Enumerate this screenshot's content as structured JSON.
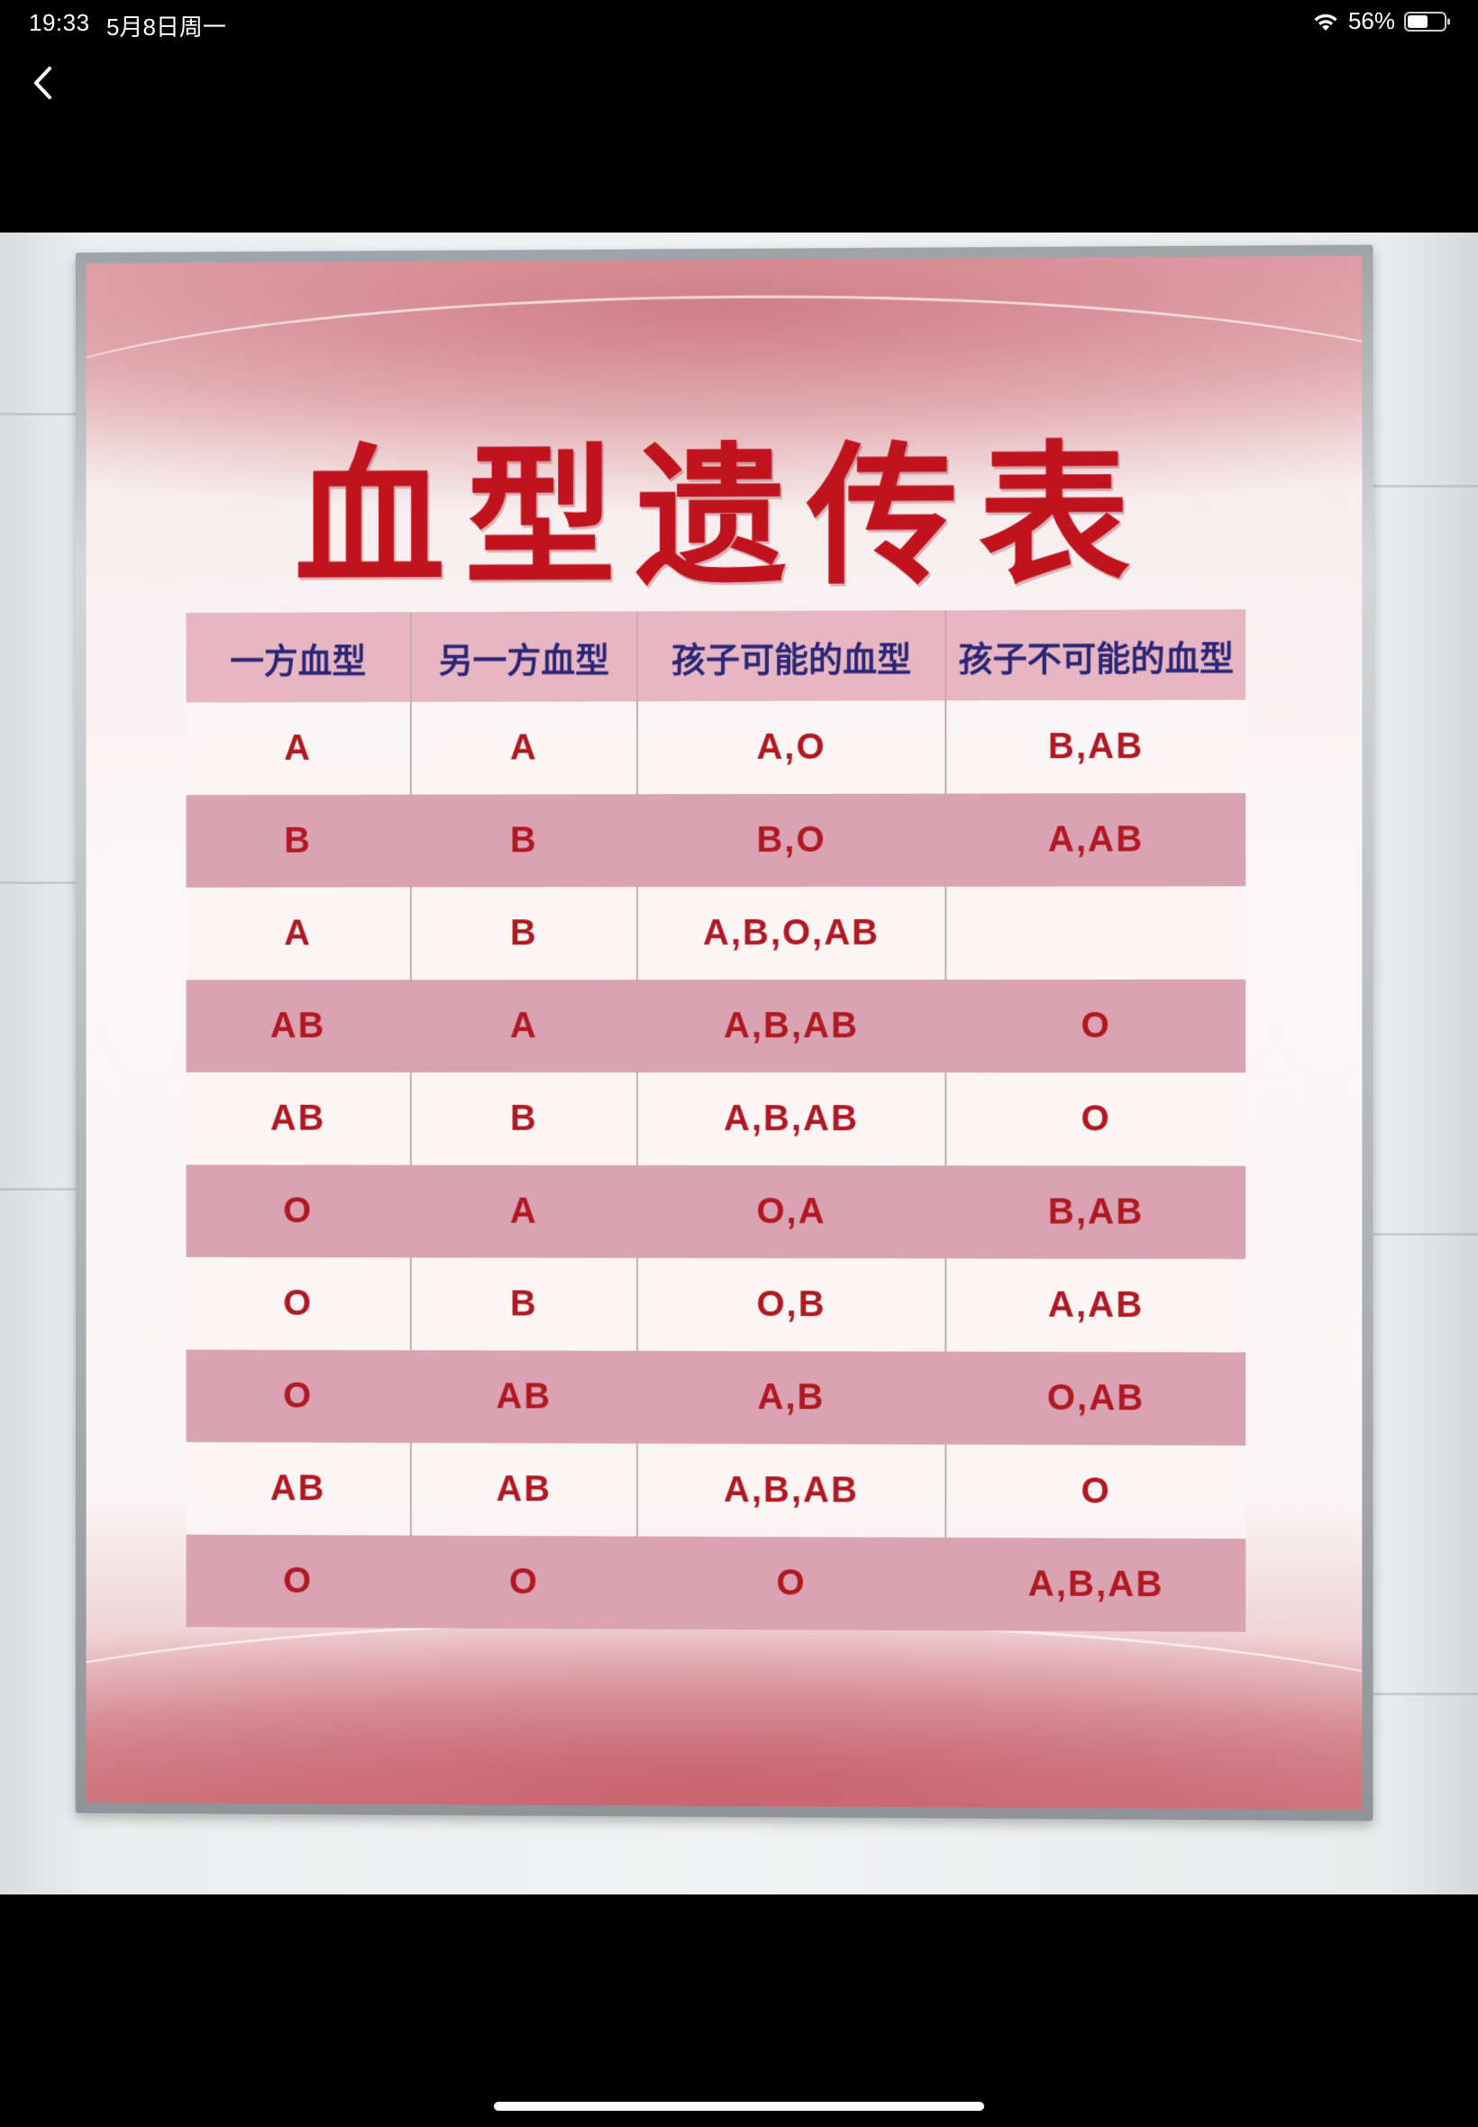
{
  "status_bar": {
    "time": "19:33",
    "date": "5月8日周一",
    "battery": "56%"
  },
  "poster": {
    "title": "血型遗传表",
    "table": {
      "headers": [
        "一方血型",
        "另一方血型",
        "孩子可能的血型",
        "孩子不可能的血型"
      ],
      "rows": [
        [
          "A",
          "A",
          "A,O",
          "B,AB"
        ],
        [
          "B",
          "B",
          "B,O",
          "A,AB"
        ],
        [
          "A",
          "B",
          "A,B,O,AB",
          ""
        ],
        [
          "AB",
          "A",
          "A,B,AB",
          "O"
        ],
        [
          "AB",
          "B",
          "A,B,AB",
          "O"
        ],
        [
          "O",
          "A",
          "O,A",
          "B,AB"
        ],
        [
          "O",
          "B",
          "O,B",
          "A,AB"
        ],
        [
          "O",
          "AB",
          "A,B",
          "O,AB"
        ],
        [
          "AB",
          "AB",
          "A,B,AB",
          "O"
        ],
        [
          "O",
          "O",
          "O",
          "A,B,AB"
        ]
      ]
    }
  },
  "icons": {
    "back": "chevron-left-icon",
    "wifi": "wifi-icon",
    "battery": "battery-icon"
  },
  "colors": {
    "title_red": "#c0131e",
    "header_navy": "#2a2576",
    "cell_red": "#b01822",
    "row_pink": "#dba2b3"
  }
}
